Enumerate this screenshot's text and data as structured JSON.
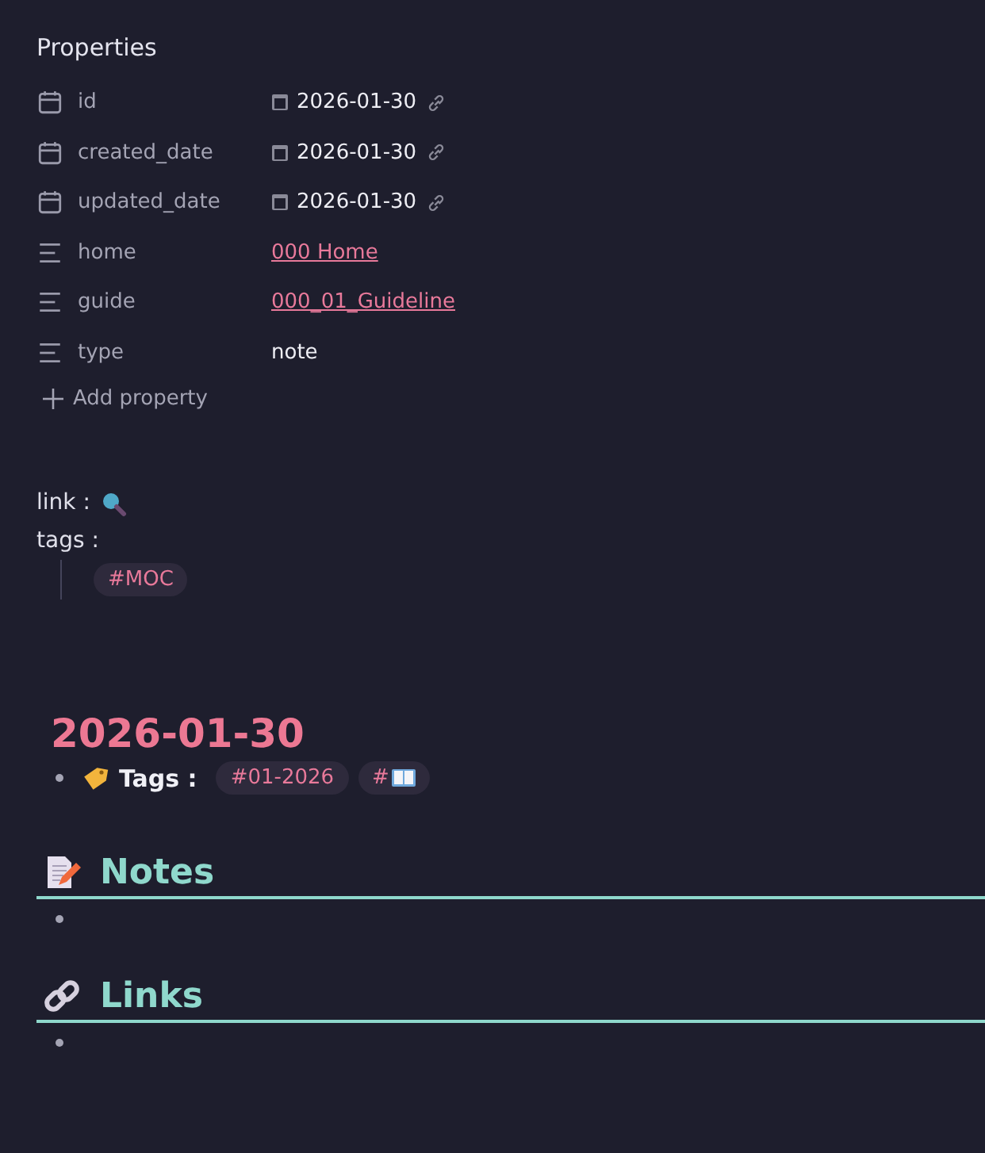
{
  "properties": {
    "title": "Properties",
    "rows": [
      {
        "kind": "date",
        "name": "id",
        "value": "2026-01-30"
      },
      {
        "kind": "date",
        "name": "created_date",
        "value": "2026-01-30"
      },
      {
        "kind": "date",
        "name": "updated_date",
        "value": "2026-01-30"
      },
      {
        "kind": "link",
        "name": "home",
        "value": "000 Home"
      },
      {
        "kind": "link",
        "name": "guide",
        "value": "000_01_Guideline"
      },
      {
        "kind": "text",
        "name": "type",
        "value": "note"
      }
    ],
    "add_label": "Add property"
  },
  "body": {
    "link_label": "link :",
    "tags_label": "tags :",
    "tags": [
      "#MOC"
    ]
  },
  "daily": {
    "heading": "2026-01-30",
    "tags_label": "Tags :",
    "tags": [
      {
        "text": "#01-2026"
      },
      {
        "text": "#",
        "kind": "book"
      }
    ]
  },
  "sections": [
    {
      "kind": "notes",
      "heading": "Notes"
    },
    {
      "kind": "links",
      "heading": "Links"
    }
  ]
}
